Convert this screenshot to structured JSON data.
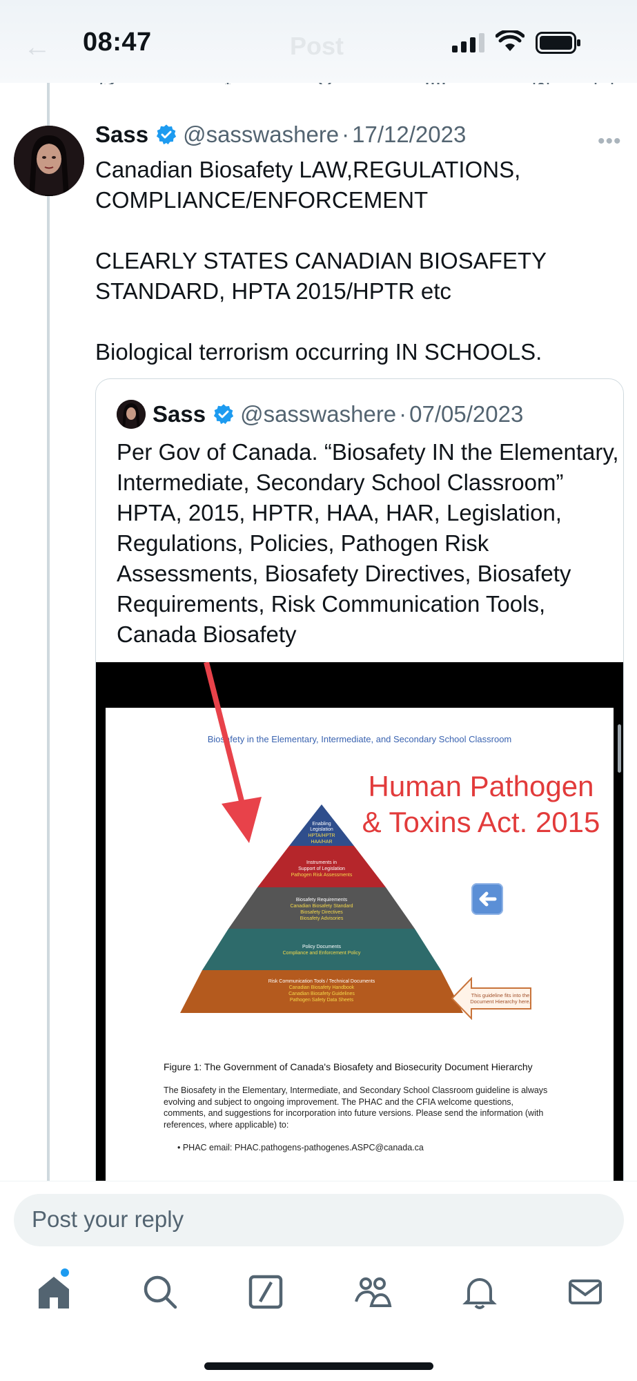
{
  "status_bar": {
    "time": "08:47"
  },
  "header": {
    "title": "Post"
  },
  "tweet": {
    "author_name": "Sass",
    "author_handle": "@sasswashere",
    "separator": "·",
    "date": "17/12/2023",
    "text": "Canadian Biosafety LAW,REGULATIONS, COMPLIANCE/ENFORCEMENT\n\nCLEARLY STATES CANADIAN BIOSAFETY STANDARD, HPTA 2015/HPTR etc\n\nBiological terrorism occurring IN SCHOOLS."
  },
  "quote": {
    "author_name": "Sass",
    "author_handle": "@sasswashere",
    "separator": "·",
    "date": "07/05/2023",
    "text": "Per Gov of Canada. “Biosafety IN the Elementary, Intermediate, Secondary School Classroom” HPTA, 2015, HPTR, HAA, HAR, Legislation, Regulations, Policies, Pathogen Risk Assessments, Biosafety Directives, Biosafety Requirements, Risk Communication Tools, Canada Biosafety"
  },
  "media": {
    "doc_header": "Biosafety in the Elementary, Intermediate, and Secondary School Classroom",
    "overlay_text": "Human Pathogen & Toxins Act. 2015",
    "pyramid": [
      {
        "title": "Enabling Legislation",
        "items": "HPTA/HPTR HAA/HAR",
        "color": "#2f4e8c"
      },
      {
        "title": "Instruments in Support of Legislation",
        "items": "Pathogen Risk Assessments",
        "color": "#b5262b"
      },
      {
        "title": "Biosafety Requirements",
        "items": "Canadian Biosafety Standard Biosafety Directives Biosafety Advisories",
        "color": "#555555"
      },
      {
        "title": "Policy Documents",
        "items": "Compliance and Enforcement Policy",
        "color": "#2e6b6b"
      },
      {
        "title": "Risk Communication Tools / Technical Documents",
        "items": "Canadian Biosafety Handbook Canadian Biosafety Guidelines Pathogen Safety Data Sheets",
        "color": "#b45a1e"
      }
    ],
    "side_note": "This guideline fits into the Document Hierarchy here.",
    "figure_caption": "Figure 1: The Government of Canada's Biosafety and Biosecurity Document Hierarchy",
    "body_text": "The Biosafety in the Elementary, Intermediate, and Secondary School Classroom guideline is always evolving and subject to ongoing improvement. The PHAC and the CFIA welcome questions, comments, and suggestions for incorporation into future versions. Please send the information (with references, where applicable) to:",
    "email_bullet": "•   PHAC email: PHAC.pathogens-pathogenes.ASPC@canada.ca"
  },
  "reply": {
    "placeholder": "Post your reply"
  },
  "nav": {
    "items": [
      "home-icon",
      "search-icon",
      "grok-icon",
      "communities-icon",
      "notifications-icon",
      "messages-icon"
    ]
  },
  "colors": {
    "accent": "#1d9bf0",
    "text": "#0f1419",
    "muted": "#536471",
    "border": "#cfd9de"
  }
}
